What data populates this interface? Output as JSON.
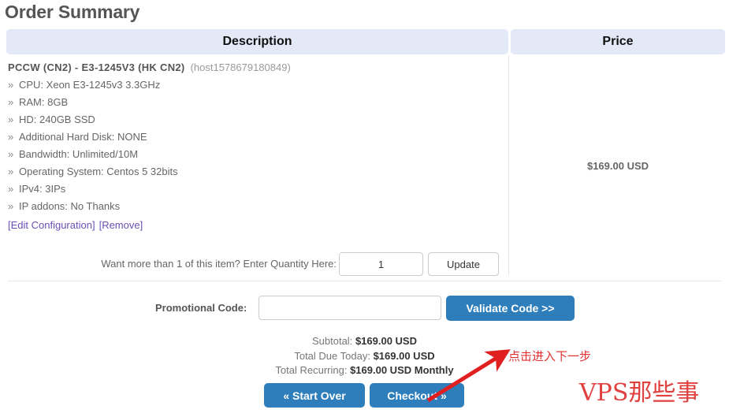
{
  "page_title": "Order Summary",
  "table": {
    "header_description": "Description",
    "header_price": "Price"
  },
  "item": {
    "name": "PCCW  (CN2)  - E3-1245V3  (HK CN2)",
    "host_id": "(host1578679180849)",
    "specs": [
      "CPU: Xeon E3-1245v3 3.3GHz",
      "RAM: 8GB",
      "HD: 240GB SSD",
      "Additional Hard Disk: NONE",
      "Bandwidth: Unlimited/10M",
      "Operating System: Centos 5 32bits",
      "IPv4: 3IPs",
      "IP addons: No Thanks"
    ],
    "spec_bullet": "»",
    "edit_link": "[Edit Configuration]",
    "remove_link": "[Remove]",
    "price": "$169.00 USD"
  },
  "quantity": {
    "label": "Want more than 1 of this item? Enter Quantity Here:",
    "value": "1",
    "update_label": "Update"
  },
  "promo": {
    "label": "Promotional Code:",
    "value": "",
    "placeholder": "",
    "validate_label": "Validate Code >>"
  },
  "totals": {
    "subtotal_label": "Subtotal:",
    "subtotal_value": "$169.00 USD",
    "due_today_label": "Total Due Today:",
    "due_today_value": "$169.00 USD",
    "recurring_label": "Total Recurring:",
    "recurring_value": "$169.00 USD Monthly"
  },
  "actions": {
    "start_over_label": "« Start Over",
    "checkout_label": "Checkout »"
  },
  "annotations": {
    "arrow_note": "点击进入下一步",
    "watermark": "VPS那些事",
    "annotation_color": "#e03030"
  },
  "colors": {
    "header_bg": "#e4e9f7",
    "button_blue": "#2e7ebb",
    "link": "#6a4fb5"
  }
}
